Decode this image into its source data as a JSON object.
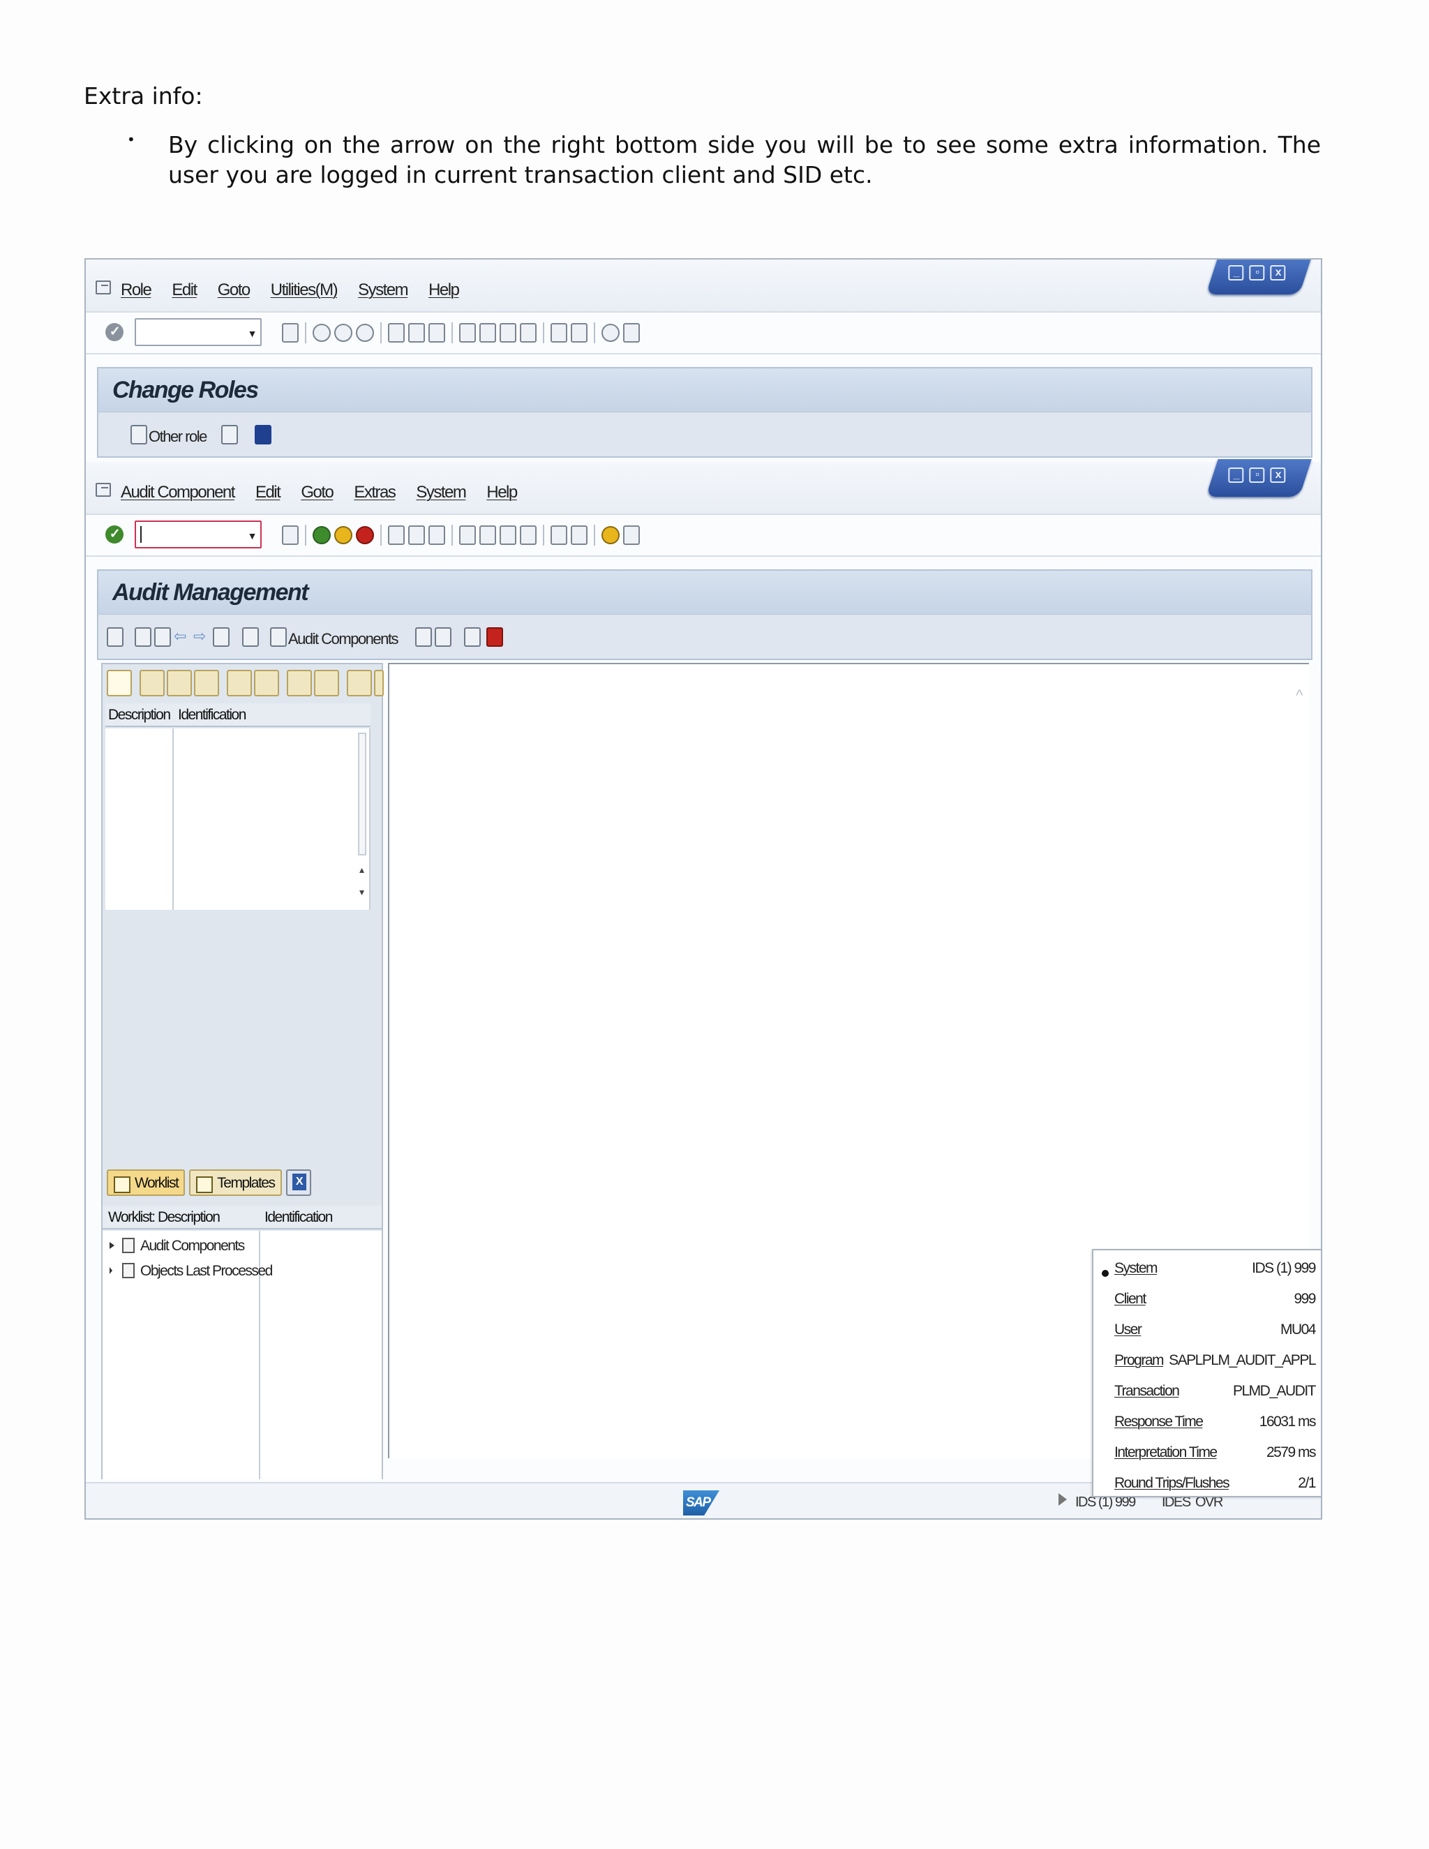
{
  "document": {
    "heading": "Extra info:",
    "bullet": "•",
    "paragraph": "By clicking on the arrow on the right bottom side you will be to see some extra information. The user you are logged in current transaction client and SID etc."
  },
  "window1": {
    "menu": [
      "Role",
      "Edit",
      "Goto",
      "Utilities(M)",
      "System",
      "Help"
    ],
    "title": "Change Roles",
    "toolbar": {
      "other_role": "Other role"
    }
  },
  "window2": {
    "menu": [
      "Audit Component",
      "Edit",
      "Goto",
      "Extras",
      "System",
      "Help"
    ],
    "title": "Audit Management",
    "toolbar": {
      "audit_components": "Audit Components"
    },
    "grid_columns": [
      "Description",
      "Identification"
    ],
    "tabs": [
      "Worklist",
      "Templates"
    ],
    "worklist_columns": [
      "Worklist: Description",
      "Identification"
    ],
    "tree": [
      "Audit Components",
      "Objects Last Processed"
    ]
  },
  "status": {
    "logo": "SAP",
    "system": "IDS (1) 999",
    "host": "IDES",
    "mode": "OVR"
  },
  "popup": {
    "rows": [
      {
        "label": "System",
        "value": "IDS (1) 999"
      },
      {
        "label": "Client",
        "value": "999"
      },
      {
        "label": "User",
        "value": "MU04"
      },
      {
        "label": "Program",
        "value": "SAPLPLM_AUDIT_APPL"
      },
      {
        "label": "Transaction",
        "value": "PLMD_AUDIT"
      },
      {
        "label": "Response Time",
        "value": "16031 ms"
      },
      {
        "label": "Interpretation Time",
        "value": "2579 ms"
      },
      {
        "label": "Round Trips/Flushes",
        "value": "2/1"
      }
    ]
  }
}
